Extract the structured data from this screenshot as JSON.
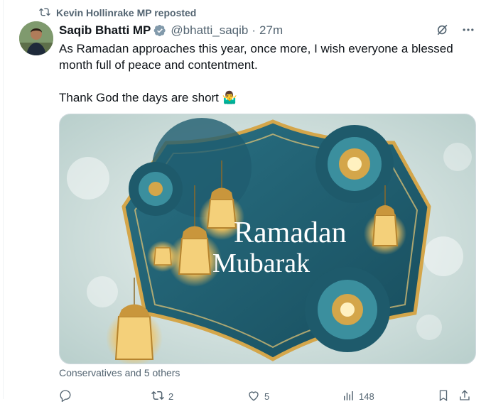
{
  "repost": {
    "text": "Kevin Hollinrake MP reposted"
  },
  "tweet": {
    "author_name": "Saqib Bhatti MP",
    "handle": "@bhatti_saqib",
    "separator": "·",
    "time": "27m",
    "text": "As Ramadan approaches this year, once more, I wish everyone a blessed month full of peace and contentment.\n\nThank God the days are short 🤷‍♂️",
    "media": {
      "line1": "Ramadan",
      "line2": "Mubarak"
    },
    "caption": "Conservatives and 5 others"
  },
  "actions": {
    "reply_count": "",
    "repost_count": "2",
    "like_count": "5",
    "views_count": "148"
  },
  "colors": {
    "secondary_text": "#536471",
    "teal": "#1e5a6b",
    "gold": "#d4a64a",
    "verified_badge": "#829aab"
  }
}
